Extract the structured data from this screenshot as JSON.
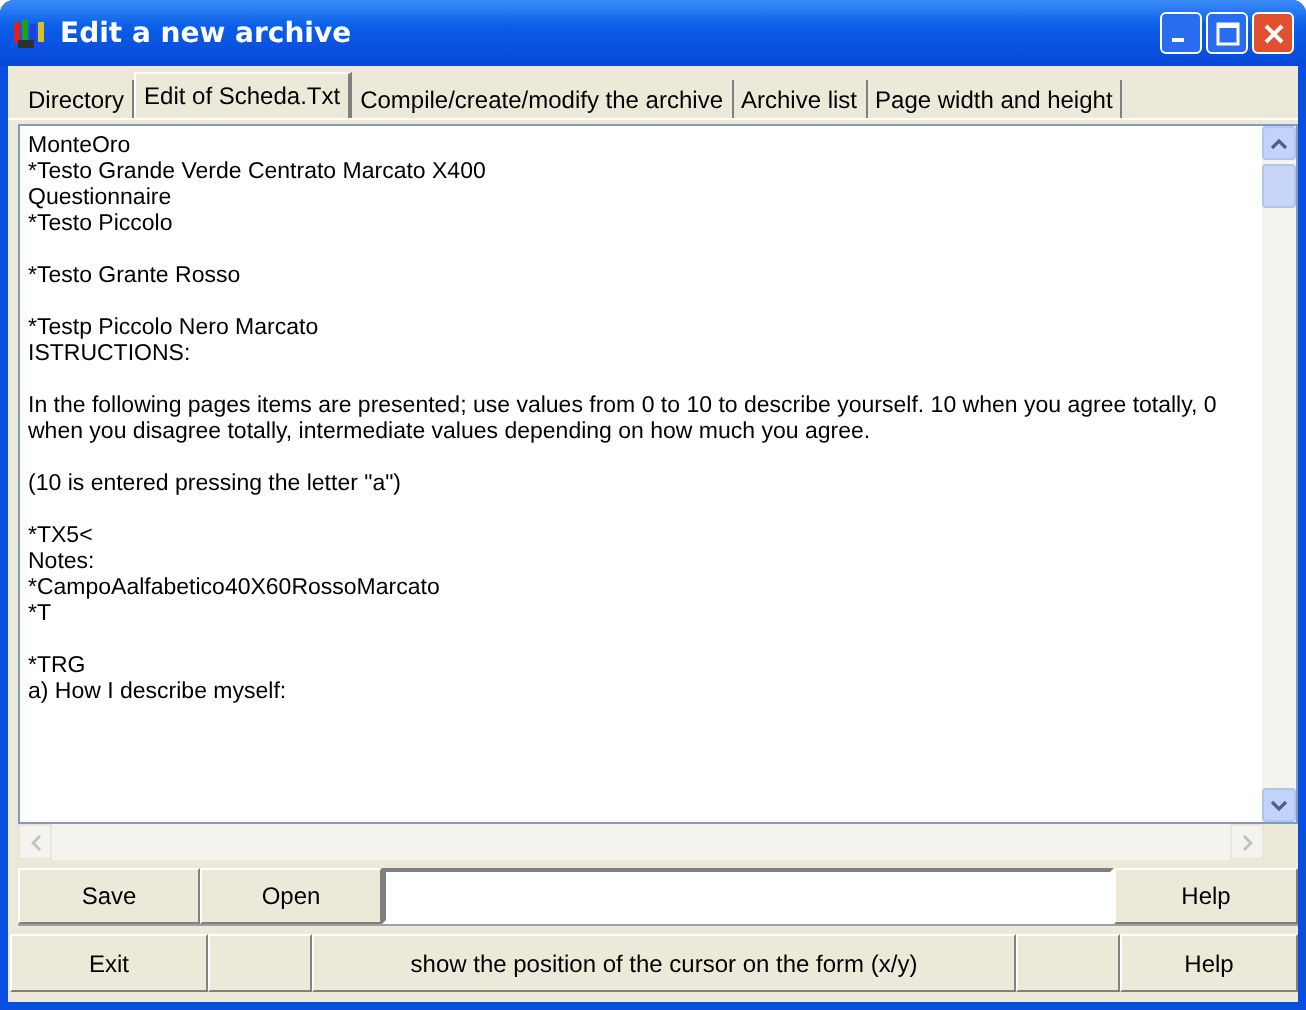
{
  "window": {
    "title": "Edit a new archive"
  },
  "tabs": [
    {
      "label": "Directory",
      "selected": false
    },
    {
      "label": "Edit of Scheda.Txt",
      "selected": true
    },
    {
      "label": "Compile/create/modify the archive",
      "selected": false
    },
    {
      "label": "Archive list",
      "selected": false
    },
    {
      "label": "Page width and height",
      "selected": false
    }
  ],
  "editor": {
    "blocks": [
      {
        "lines": [
          "MonteOro",
          "*Testo Grande Verde Centrato Marcato X400",
          "Questionnaire",
          "*Testo Piccolo"
        ]
      },
      {
        "lines": [
          "*Testo Grante Rosso"
        ]
      },
      {
        "lines": [
          "*Testp Piccolo Nero Marcato",
          "ISTRUCTIONS:"
        ]
      },
      {
        "lines": [
          "In the following pages items are presented; use values from 0 to 10 to describe yourself. 10 when you agree totally, 0 when you disagree totally, intermediate values depending on how much you agree."
        ]
      },
      {
        "lines": [
          "(10 is entered pressing the letter \"a\")"
        ]
      },
      {
        "lines": [
          "*TX5<",
          "Notes:",
          "*CampoAalfabetico40X60RossoMarcato",
          "*T"
        ]
      },
      {
        "lines": [
          "*TRG",
          "a) How I describe myself:"
        ]
      }
    ]
  },
  "toolbar": {
    "save": "Save",
    "open": "Open",
    "help": "Help"
  },
  "status_bar": {
    "exit": "Exit",
    "message": "show the position of the cursor on the form (x/y)",
    "help": "Help"
  }
}
